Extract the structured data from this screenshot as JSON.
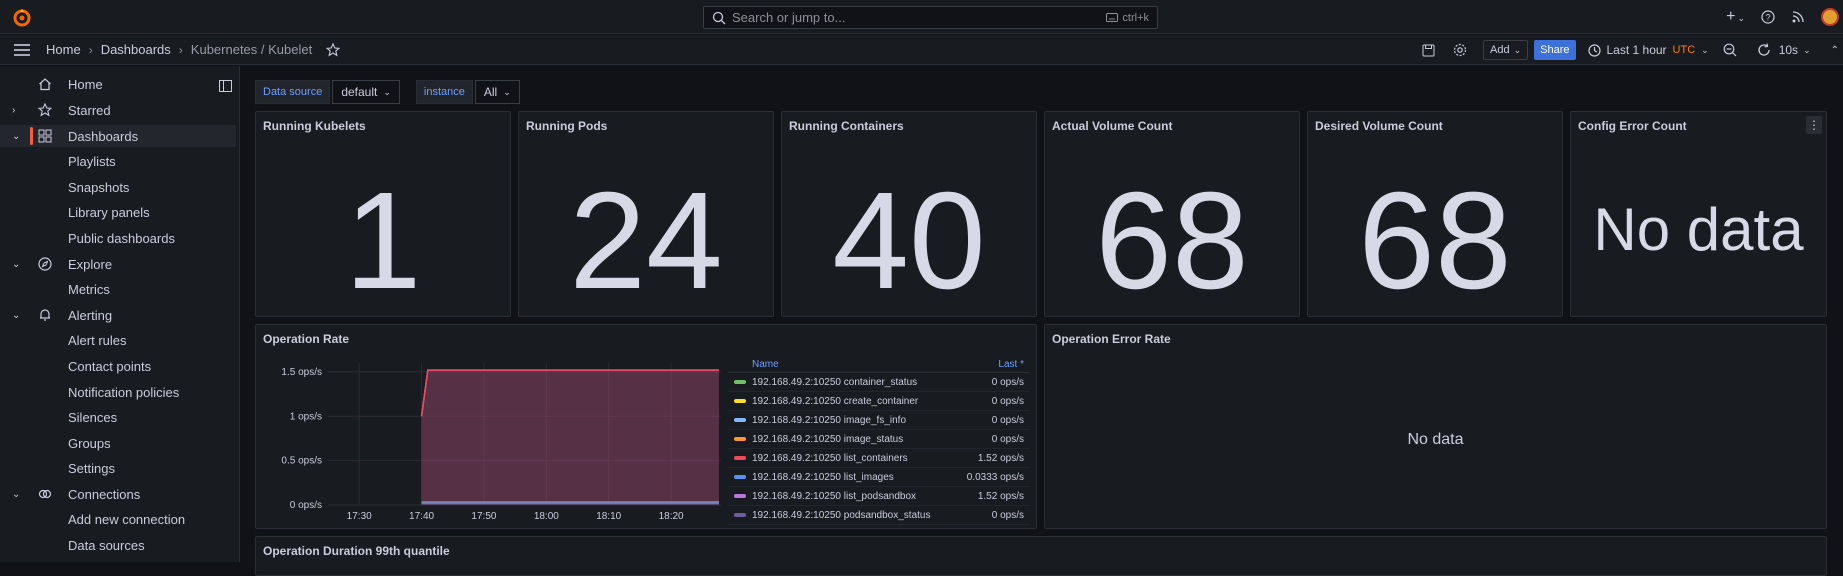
{
  "search": {
    "placeholder": "Search or jump to...",
    "shortcut": "ctrl+k"
  },
  "breadcrumbs": {
    "home": "Home",
    "dashboards": "Dashboards",
    "current": "Kubernetes / Kubelet"
  },
  "toolbar": {
    "add_label": "Add",
    "share_label": "Share",
    "time_range": "Last 1 hour",
    "timezone": "UTC",
    "refresh": "10s"
  },
  "sidebar": {
    "items": [
      {
        "label": "Home"
      },
      {
        "label": "Starred"
      },
      {
        "label": "Dashboards"
      },
      {
        "label": "Playlists"
      },
      {
        "label": "Snapshots"
      },
      {
        "label": "Library panels"
      },
      {
        "label": "Public dashboards"
      },
      {
        "label": "Explore"
      },
      {
        "label": "Metrics"
      },
      {
        "label": "Alerting"
      },
      {
        "label": "Alert rules"
      },
      {
        "label": "Contact points"
      },
      {
        "label": "Notification policies"
      },
      {
        "label": "Silences"
      },
      {
        "label": "Groups"
      },
      {
        "label": "Settings"
      },
      {
        "label": "Connections"
      },
      {
        "label": "Add new connection"
      },
      {
        "label": "Data sources"
      }
    ]
  },
  "variables": {
    "datasource_label": "Data source",
    "datasource_value": "default",
    "instance_label": "instance",
    "instance_value": "All"
  },
  "stats": [
    {
      "title": "Running Kubelets",
      "value": "1"
    },
    {
      "title": "Running Pods",
      "value": "24"
    },
    {
      "title": "Running Containers",
      "value": "40"
    },
    {
      "title": "Actual Volume Count",
      "value": "68"
    },
    {
      "title": "Desired Volume Count",
      "value": "68"
    },
    {
      "title": "Config Error Count",
      "value": "No data"
    }
  ],
  "operation_rate": {
    "title": "Operation Rate",
    "legend_headers": {
      "name": "Name",
      "last": "Last *"
    },
    "legend": [
      {
        "name": "192.168.49.2:10250 container_status",
        "last": "0 ops/s",
        "color": "#73bf69"
      },
      {
        "name": "192.168.49.2:10250 create_container",
        "last": "0 ops/s",
        "color": "#fade2a"
      },
      {
        "name": "192.168.49.2:10250 image_fs_info",
        "last": "0 ops/s",
        "color": "#8ab8ff"
      },
      {
        "name": "192.168.49.2:10250 image_status",
        "last": "0 ops/s",
        "color": "#ff9830"
      },
      {
        "name": "192.168.49.2:10250 list_containers",
        "last": "1.52 ops/s",
        "color": "#f2495c"
      },
      {
        "name": "192.168.49.2:10250 list_images",
        "last": "0.0333 ops/s",
        "color": "#5794f2"
      },
      {
        "name": "192.168.49.2:10250 list_podsandbox",
        "last": "1.52 ops/s",
        "color": "#b877d9"
      },
      {
        "name": "192.168.49.2:10250 podsandbox_status",
        "last": "0 ops/s",
        "color": "#705da0"
      }
    ],
    "chart_data": {
      "type": "area",
      "x_ticks": [
        "17:30",
        "17:40",
        "17:50",
        "18:00",
        "18:10",
        "18:20"
      ],
      "y_ticks": [
        "0 ops/s",
        "0.5 ops/s",
        "1 ops/s",
        "1.5 ops/s"
      ],
      "ylim": [
        0,
        1.6
      ],
      "series": [
        {
          "name": "192.168.49.2:10250 list_podsandbox",
          "color": "#b877d9",
          "x": [
            "17:40",
            "17:41",
            "18:27"
          ],
          "values": [
            1.0,
            1.52,
            1.52
          ]
        },
        {
          "name": "192.168.49.2:10250 list_containers",
          "color": "#f2495c",
          "x": [
            "17:40",
            "17:41",
            "18:27"
          ],
          "values": [
            1.0,
            1.52,
            1.52
          ]
        },
        {
          "name": "192.168.49.2:10250 list_images",
          "color": "#5794f2",
          "x": [
            "17:40",
            "18:27"
          ],
          "values": [
            0.0333,
            0.0333
          ]
        }
      ]
    }
  },
  "operation_error_rate": {
    "title": "Operation Error Rate",
    "no_data": "No data"
  },
  "operation_duration": {
    "title": "Operation Duration 99th quantile"
  }
}
